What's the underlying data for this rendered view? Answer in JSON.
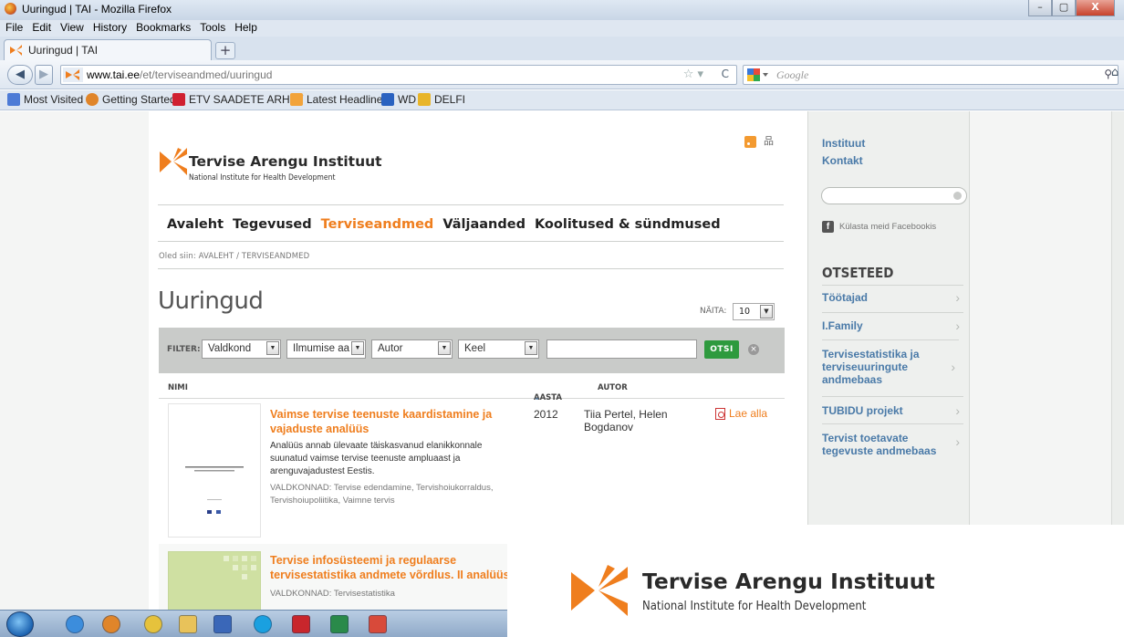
{
  "window": {
    "title": "Uuringud | TAI - Mozilla Firefox",
    "controls": [
      "–",
      "▢",
      "X"
    ]
  },
  "menu": [
    "File",
    "Edit",
    "View",
    "History",
    "Bookmarks",
    "Tools",
    "Help"
  ],
  "tab": {
    "label": "Uuringud | TAI",
    "new_tab": "+"
  },
  "nav": {
    "url_host": "www.tai.ee",
    "url_path": "/et/terviseandmed/uuringud",
    "search_placeholder": "Google"
  },
  "bookmarks": [
    {
      "label": "Most Visited",
      "icon": "most-visited-icon",
      "color": "#4d7bd6"
    },
    {
      "label": "Getting Started",
      "icon": "firefox-icon",
      "color": "#e0852a"
    },
    {
      "label": "ETV SAADETE ARHIIV",
      "icon": "etv-icon",
      "color": "#d02030"
    },
    {
      "label": "Latest Headlines",
      "icon": "rss-feed-icon",
      "color": "#f2a33a"
    },
    {
      "label": "WD",
      "icon": "wd-icon",
      "color": "#2a62c0"
    },
    {
      "label": "DELFI",
      "icon": "delfi-icon",
      "color": "#e8b52a"
    }
  ],
  "site": {
    "brand_name": "Tervise Arengu Instituut",
    "brand_sub": "National Institute for Health Development",
    "accent": "#ef7e1e",
    "link_color": "#4a7aa8",
    "main_nav": [
      "Avaleht",
      "Tegevused",
      "Terviseandmed",
      "Väljaanded",
      "Koolitused & sündmused"
    ],
    "breadcrumb": "Oled siin:  AVALEHT  /  TERVISEANDMED",
    "heading": "Uuringud",
    "show_label": "NÄITA:",
    "show_value": "10",
    "filter": {
      "label": "FILTER:",
      "selects": [
        "Valdkond",
        "Ilmumise aa",
        "Autor",
        "Keel"
      ],
      "button": "OTSI"
    },
    "table_header": {
      "name": "NIMI",
      "year": "AASTA",
      "author": "AUTOR"
    },
    "items": [
      {
        "title": "Vaimse tervise teenuste kaardistamine ja vajaduste analüüs",
        "description": "Analüüs annab ülevaate täiskasvanud elanikkonnale suunatud vaimse tervise teenuste ampluaast ja arenguvajadustest Eestis.",
        "tags": "VALDKONNAD:  Tervise edendamine, Tervishoiukorraldus, Tervishoiupoliitika, Vaimne tervis",
        "year": "2012",
        "author": "Tiia Pertel, Helen Bogdanov",
        "download": "Lae alla"
      },
      {
        "title": "Tervise infosüsteemi ja regulaarse tervisestatistika andmete võrdlus. II analüüs",
        "tags": "VALDKONNAD:  Tervisestatistika"
      }
    ]
  },
  "sidebar": {
    "links": [
      "Instituut",
      "Kontakt"
    ],
    "facebook": "Külasta meid Facebookis",
    "heading": "OTSETEED",
    "shortcuts": [
      "Töötajad",
      "I.Family",
      "Tervisestatistika ja terviseuuringute andmebaas",
      "TUBIDU projekt",
      "Tervist toetavate tegevuste andmebaas"
    ]
  },
  "overlay": {
    "brand_name": "Tervise Arengu Instituut",
    "brand_sub": "National Institute for Health Development"
  },
  "taskbar": [
    {
      "icon": "ie-icon",
      "color": "#3c8ddc"
    },
    {
      "icon": "firefox-icon",
      "color": "#e0852a"
    },
    {
      "icon": "chrome-icon",
      "color": "#e6c23c"
    },
    {
      "icon": "folder-icon",
      "color": "#e8c25a"
    },
    {
      "icon": "media-player-icon",
      "color": "#3a67b8"
    },
    {
      "icon": "skype-icon",
      "color": "#1aa0e0"
    },
    {
      "icon": "acrobat-icon",
      "color": "#c8262c"
    },
    {
      "icon": "excel-icon",
      "color": "#2a8a4a"
    },
    {
      "icon": "app-icon",
      "color": "#d84a3a"
    }
  ]
}
